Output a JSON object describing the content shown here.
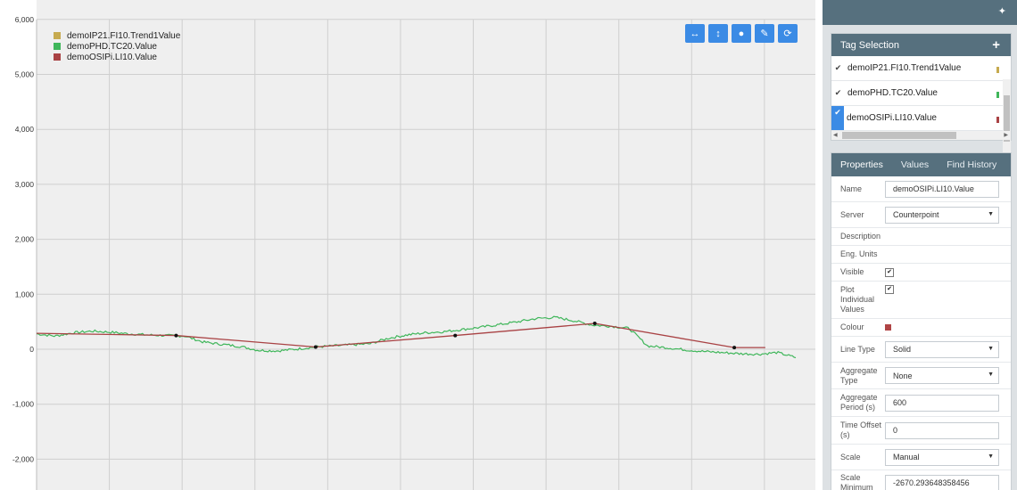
{
  "chart": {
    "legend": [
      {
        "label": "demoIP21.FI10.Trend1Value",
        "color": "#c6aa4f"
      },
      {
        "label": "demoPHD.TC20.Value",
        "color": "#3fb65a"
      },
      {
        "label": "demoOSIPi.LI10.Value",
        "color": "#a94244"
      }
    ],
    "toolbar": [
      {
        "name": "pan-horizontal-icon",
        "glyph": "↔"
      },
      {
        "name": "pan-vertical-icon",
        "glyph": "↕"
      },
      {
        "name": "comment-icon",
        "glyph": "●"
      },
      {
        "name": "pencil-icon",
        "glyph": "✎"
      },
      {
        "name": "refresh-icon",
        "glyph": "⟳"
      }
    ]
  },
  "chart_data": {
    "type": "line",
    "y_ticks": [
      "6,000",
      "5,000",
      "4,000",
      "3,000",
      "2,000",
      "1,000",
      "0",
      "-1,000",
      "-2,000"
    ],
    "ylim": [
      -2500,
      6000
    ],
    "grid": true,
    "legend_position": "top-left",
    "series": [
      {
        "name": "demoIP21.FI10.Trend1Value",
        "values": []
      },
      {
        "name": "demoPHD.TC20.Value",
        "values": [
          280,
          240,
          300,
          330,
          310,
          280,
          260,
          250,
          240,
          130,
          90,
          50,
          -20,
          -30,
          0,
          40,
          60,
          80,
          100,
          200,
          260,
          300,
          320,
          360,
          400,
          450,
          500,
          560,
          580,
          520,
          440,
          420,
          380,
          60,
          30,
          -10,
          -40,
          -60,
          -80,
          -90,
          -60,
          -150
        ]
      },
      {
        "name": "demoOSIPi.LI10.Value",
        "x": [
          0.0,
          0.18,
          0.36,
          0.54,
          0.72,
          0.9,
          0.94
        ],
        "values": [
          290,
          250,
          40,
          250,
          470,
          30,
          30
        ]
      }
    ]
  },
  "side": {
    "pin_glyph": "✦",
    "tag_selection": {
      "title": "Tag Selection",
      "add_glyph": "+",
      "tags": [
        {
          "check": "✔",
          "label": "demoIP21.FI10.Trend1Value",
          "color": "#c6aa4f",
          "selected": false
        },
        {
          "check": "✔",
          "label": "demoPHD.TC20.Value",
          "color": "#3fb65a",
          "selected": false
        },
        {
          "check": "✔",
          "label": "demoOSIPi.LI10.Value",
          "color": "#a94244",
          "selected": true
        }
      ]
    },
    "tabs": [
      "Properties",
      "Values",
      "Find History"
    ],
    "properties": {
      "name_label": "Name",
      "name_value": "demoOSIPi.LI10.Value",
      "server_label": "Server",
      "server_value": "Counterpoint",
      "description_label": "Description",
      "eng_units_label": "Eng. Units",
      "visible_label": "Visible",
      "visible_check": "✔",
      "plot_label": "Plot Individual Values",
      "plot_check": "✔",
      "colour_label": "Colour",
      "colour_value": "#b04445",
      "line_type_label": "Line Type",
      "line_type_value": "Solid",
      "agg_type_label": "Aggregate Type",
      "agg_type_value": "None",
      "agg_period_label": "Aggregate Period (s)",
      "agg_period_value": "600",
      "time_offset_label": "Time Offset (s)",
      "time_offset_value": "0",
      "scale_label": "Scale",
      "scale_value": "Manual",
      "scale_min_label": "Scale Minimum",
      "scale_min_value": "-2670.293648358456"
    },
    "caret": "▼"
  }
}
